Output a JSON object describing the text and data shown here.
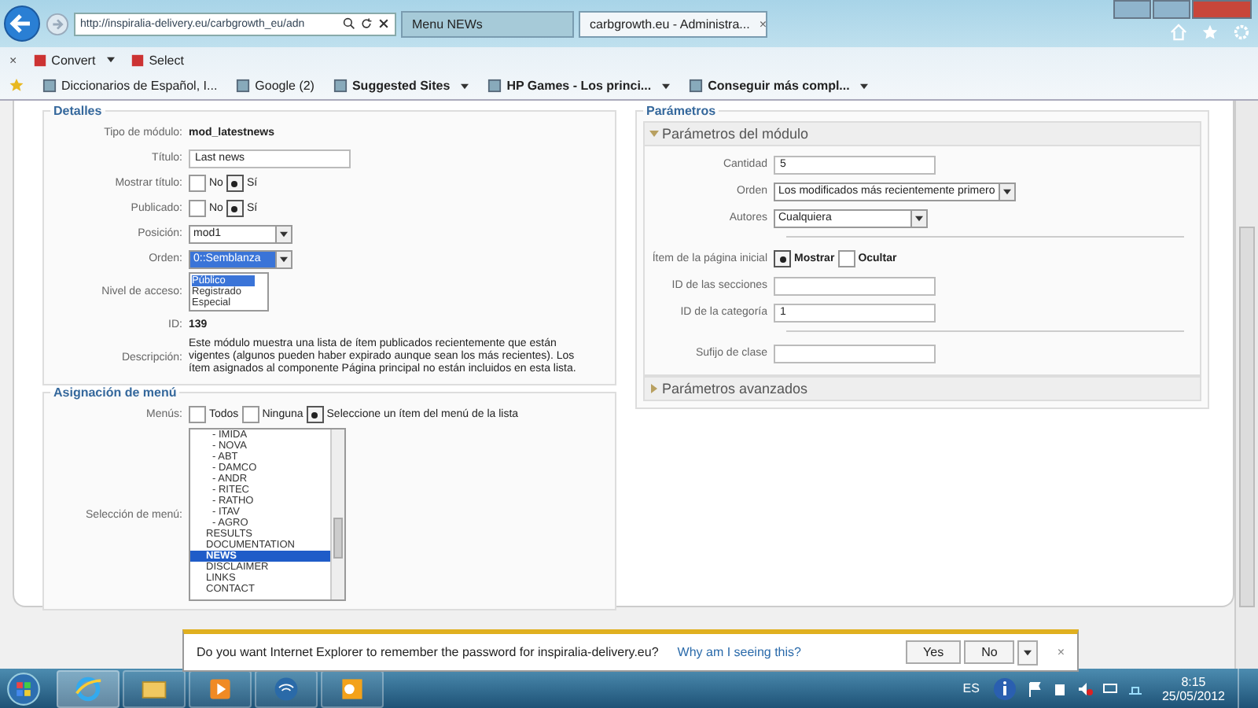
{
  "browser": {
    "address": "http://inspiralia-delivery.eu/carbgrowth_eu/adn",
    "tabs": [
      {
        "label": "Menu NEWs",
        "selected": false
      },
      {
        "label": "carbgrowth.eu - Administra...",
        "selected": true
      }
    ],
    "tab_close": "×"
  },
  "command_bar": {
    "close": "×",
    "items": [
      {
        "label": "Convert",
        "menu": true
      },
      {
        "label": "Select",
        "menu": false
      }
    ]
  },
  "favorites": [
    {
      "label": "Diccionarios de Español, I...",
      "menu": false
    },
    {
      "label": "Google (2)",
      "menu": false
    },
    {
      "label": "Suggested Sites",
      "menu": true
    },
    {
      "label": "HP Games - Los princi...",
      "menu": true
    },
    {
      "label": "Conseguir más compl...",
      "menu": true
    }
  ],
  "details": {
    "title": "Detalles",
    "fields": [
      {
        "kind": "text",
        "label": "Tipo de módulo:",
        "value": "mod_latestnews"
      },
      {
        "kind": "input",
        "label": "Título:",
        "value": "Last news"
      },
      {
        "kind": "radio",
        "label": "Mostrar título:",
        "options": [
          {
            "label": "No",
            "selected": false
          },
          {
            "label": "Sí",
            "selected": true
          }
        ]
      },
      {
        "kind": "radio",
        "label": "Publicado:",
        "options": [
          {
            "label": "No",
            "selected": false
          },
          {
            "label": "Sí",
            "selected": true
          }
        ]
      },
      {
        "kind": "select",
        "label": "Posición:",
        "value": "mod1",
        "focused": false
      },
      {
        "kind": "select",
        "label": "Orden:",
        "value": "0::Semblanza",
        "focused": true
      },
      {
        "kind": "listbox",
        "label": "Nivel de acceso:",
        "options": [
          {
            "label": "Público",
            "selected": true
          },
          {
            "label": "Registrado",
            "selected": false
          },
          {
            "label": "Especial",
            "selected": false
          }
        ]
      },
      {
        "kind": "text",
        "label": "ID:",
        "value": "139"
      },
      {
        "kind": "desc",
        "label": "Descripción:",
        "value": "Este módulo muestra una lista de ítem publicados recientemente que están vigentes (algunos pueden haber expirado aunque sean los más recientes). Los ítem asignados al componente Página principal no están incluidos en esta lista."
      }
    ]
  },
  "menu_assignment": {
    "title": "Asignación de menú",
    "menus_label": "Menús:",
    "menus": [
      {
        "label": "Todos",
        "selected": false
      },
      {
        "label": "Ninguna",
        "selected": false
      },
      {
        "label": "Seleccione un ítem del menú de la lista",
        "selected": true
      }
    ],
    "selection_label": "Selección de menú:",
    "items": [
      {
        "label": "- IMIDA",
        "kind": "sub",
        "selected": false
      },
      {
        "label": "- NOVA",
        "kind": "sub",
        "selected": false
      },
      {
        "label": "- ABT",
        "kind": "sub",
        "selected": false
      },
      {
        "label": "- DAMCO",
        "kind": "sub",
        "selected": false
      },
      {
        "label": "- ANDR",
        "kind": "sub",
        "selected": false
      },
      {
        "label": "- RITEC",
        "kind": "sub",
        "selected": false
      },
      {
        "label": "- RATHO",
        "kind": "sub",
        "selected": false
      },
      {
        "label": "- ITAV",
        "kind": "sub",
        "selected": false
      },
      {
        "label": "- AGRO",
        "kind": "sub",
        "selected": false
      },
      {
        "label": "RESULTS",
        "kind": "top",
        "selected": false
      },
      {
        "label": "DOCUMENTATION",
        "kind": "top",
        "selected": false
      },
      {
        "label": "NEWS",
        "kind": "top",
        "selected": true
      },
      {
        "label": "DISCLAIMER",
        "kind": "top",
        "selected": false
      },
      {
        "label": "LINKS",
        "kind": "top",
        "selected": false
      },
      {
        "label": "CONTACT",
        "kind": "top",
        "selected": false
      }
    ]
  },
  "parameters": {
    "title": "Parámetros",
    "module_section": {
      "title": "Parámetros del módulo",
      "expanded": true
    },
    "fields": [
      {
        "kind": "input",
        "label": "Cantidad",
        "value": "5"
      },
      {
        "kind": "select",
        "label": "Orden",
        "value": "Los modificados más recientemente primero"
      },
      {
        "kind": "select",
        "label": "Autores",
        "value": "Cualquiera"
      },
      {
        "kind": "divider"
      },
      {
        "kind": "radio",
        "label": "Ítem de la página inicial",
        "options": [
          {
            "label": "Mostrar",
            "selected": true
          },
          {
            "label": "Ocultar",
            "selected": false
          }
        ]
      },
      {
        "kind": "input",
        "label": "ID de las secciones"
      },
      {
        "kind": "input",
        "label": "ID de la categoría",
        "value": "1"
      },
      {
        "kind": "divider"
      },
      {
        "kind": "input",
        "label": "Sufijo de clase"
      }
    ],
    "advanced_section": {
      "title": "Parámetros avanzados",
      "expanded": false
    }
  },
  "notification": {
    "message": "Do you want Internet Explorer to remember the password for inspiralia-delivery.eu?",
    "link": "Why am I seeing this?",
    "buttons": [
      "Yes",
      "No"
    ],
    "close": "×"
  },
  "taskbar": {
    "language": "ES",
    "time": "8:15",
    "date": "25/05/2012"
  }
}
